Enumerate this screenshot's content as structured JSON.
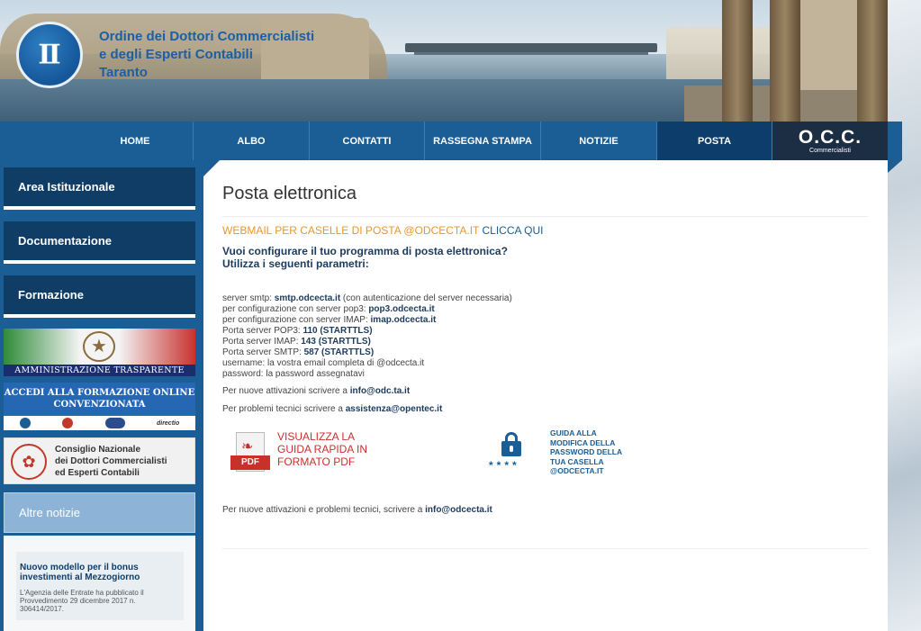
{
  "header": {
    "org_line1": "Ordine dei Dottori Commercialisti",
    "org_line2": "e degli Esperti Contabili",
    "org_line3": "Taranto"
  },
  "nav": {
    "items": [
      {
        "label": "HOME"
      },
      {
        "label": "ALBO"
      },
      {
        "label": "CONTATTI"
      },
      {
        "label": "RASSEGNA STAMPA"
      },
      {
        "label": "NOTIZIE"
      },
      {
        "label": "POSTA",
        "active": true
      }
    ],
    "occ_title": "O.C.C.",
    "occ_sub": "Commercialisti"
  },
  "sidebar": {
    "items": [
      {
        "label": "Area Istituzionale"
      },
      {
        "label": "Documentazione"
      },
      {
        "label": "Formazione"
      }
    ],
    "banner_amm": "AMMINISTRAZIONE TRASPARENTE",
    "banner_form_line1": "ACCEDI ALLA FORMAZIONE ONLINE",
    "banner_form_line2": "CONVENZIONATA",
    "banner_form_logo": "directio",
    "banner_cn_line1": "Consiglio Nazionale",
    "banner_cn_line2": "dei Dottori Commercialisti",
    "banner_cn_line3": "ed Esperti Contabili",
    "altre_notizie": "Altre notizie",
    "news_title": "Nuovo modello per il bonus investimenti al Mezzogiorno",
    "news_body": "L'Agenzia delle Entrate ha pubblicato il Provvedimento 29 dicembre 2017 n. 306414/2017."
  },
  "main": {
    "title": "Posta elettronica",
    "webmail_text": "WEBMAIL PER CASELLE DI POSTA @ODCECTA.IT",
    "webmail_link": "CLICCA QUI",
    "question_line1": "Vuoi configurare il tuo programma di posta elettronica?",
    "question_line2": "Utilizza i seguenti parametri:",
    "params": [
      {
        "label": "server smtp: ",
        "value": "smtp.odcecta.it",
        "suffix": " (con autenticazione del server necessaria)"
      },
      {
        "label": "per configurazione con server pop3: ",
        "value": "pop3.odcecta.it",
        "suffix": ""
      },
      {
        "label": "per configurazione con server IMAP: ",
        "value": "imap.odcecta.it",
        "suffix": ""
      },
      {
        "label": "Porta server POP3: ",
        "value": "110 (STARTTLS)",
        "suffix": ""
      },
      {
        "label": "Porta server IMAP: ",
        "value": "143 (STARTTLS)",
        "suffix": ""
      },
      {
        "label": "Porta server SMTP: ",
        "value": "587 (STARTTLS)",
        "suffix": ""
      },
      {
        "label": "username: la vostra email completa di @odcecta.it",
        "value": "",
        "suffix": ""
      },
      {
        "label": "password: la password assegnatavi",
        "value": "",
        "suffix": ""
      }
    ],
    "attivazioni_label": "Per nuove attivazioni scrivere a ",
    "attivazioni_email": "info@odc.ta.it",
    "problemi_label": "Per problemi tecnici scrivere a ",
    "problemi_email": "assistenza@opentec.it",
    "pdf_badge": "PDF",
    "pdf_link_text": "VISUALIZZA LA GUIDA RAPIDA IN FORMATO PDF",
    "stars": "****",
    "guide_link_text": "GUIDA ALLA MODIFICA DELLA PASSWORD DELLA TUA CASELLA @ODCECTA.IT",
    "footer_label": "Per nuove attivazioni e problemi tecnici, scrivere a ",
    "footer_email": "info@odcecta.it"
  },
  "colors": {
    "nav_bg": "#1b5d95",
    "nav_active": "#0d3e6b",
    "webmail_orange": "#e8962f",
    "pdf_red": "#c9302c"
  }
}
